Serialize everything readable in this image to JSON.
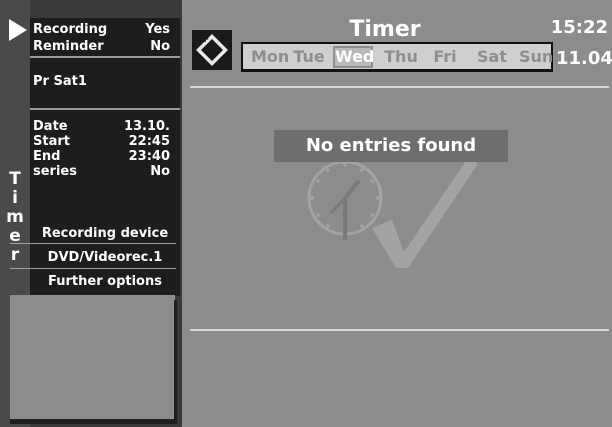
{
  "sidebar": {
    "vertical_label": "Timer",
    "rows": [
      {
        "label": "Recording",
        "value": "Yes"
      },
      {
        "label": "Reminder",
        "value": "No"
      }
    ],
    "program": "Pr  Sat1",
    "schedule": [
      {
        "label": "Date",
        "value": "13.10."
      },
      {
        "label": "Start",
        "value": "22:45"
      },
      {
        "label": "End",
        "value": "23:40"
      },
      {
        "label": "series",
        "value": "No"
      }
    ],
    "options": [
      "Recording device",
      "DVD/Videorec.1",
      "Further options"
    ]
  },
  "header": {
    "title": "Timer",
    "time": "15:22",
    "date": "11.04"
  },
  "day_bar": {
    "days": [
      "Mon",
      "Tue",
      "Wed",
      "Thu",
      "Fri",
      "Sat",
      "Sun"
    ],
    "selected": "Wed"
  },
  "main": {
    "status": "No entries found",
    "watermark_icons": [
      "clock-icon",
      "checkmark-icon"
    ]
  },
  "colors": {
    "panel_gray": "#8c8c8c",
    "sidebar_dark": "#1d1d1d",
    "status_bar": "#6e6e6e",
    "text": "#ffffff"
  }
}
